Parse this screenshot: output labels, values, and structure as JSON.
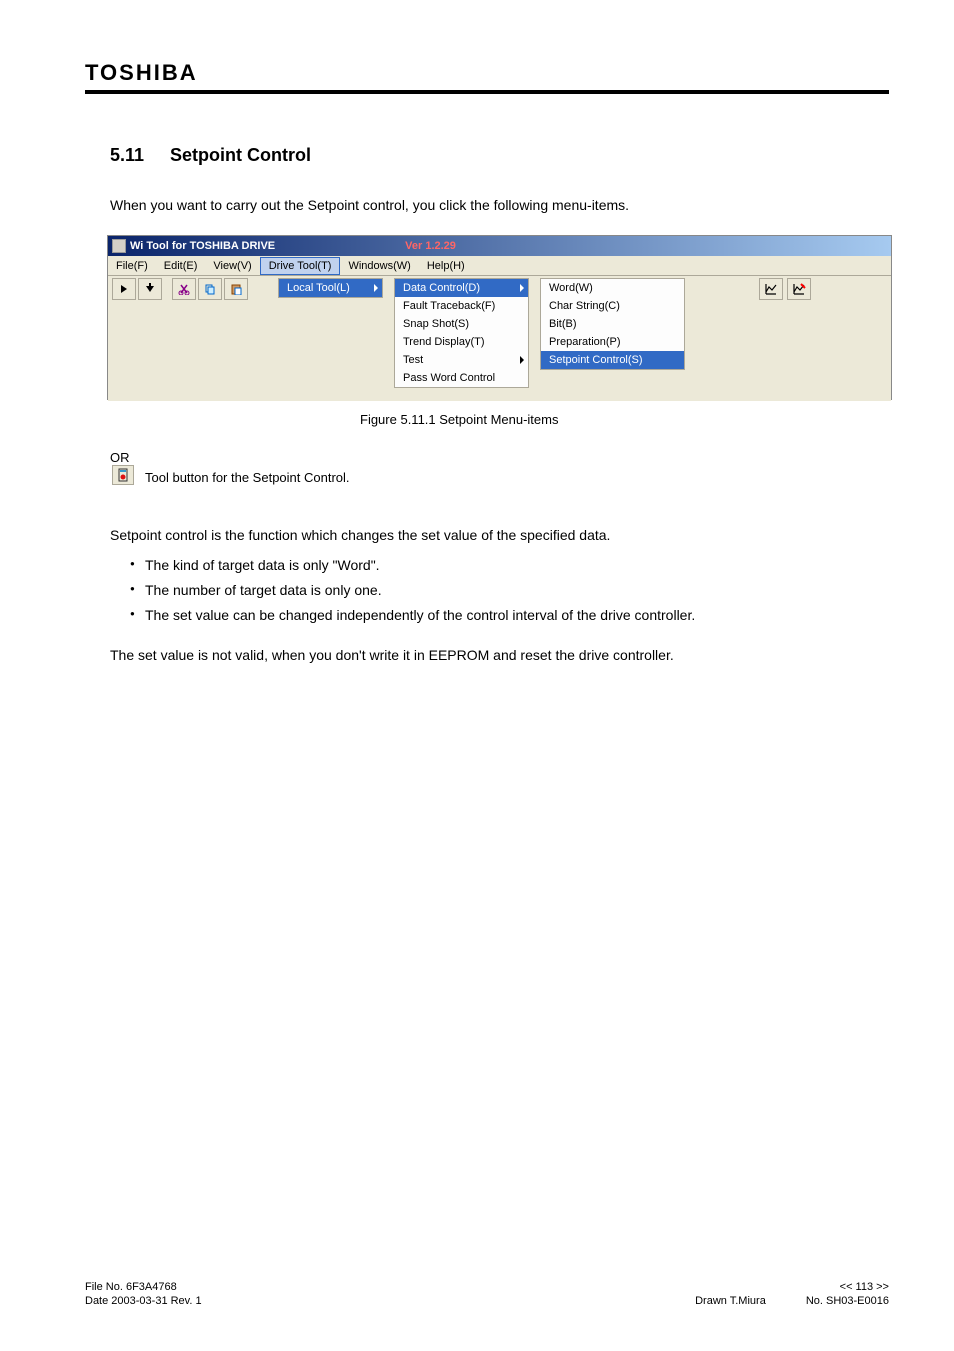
{
  "brand": "TOSHIBA",
  "section": {
    "number": "5.11",
    "title": "Setpoint Control"
  },
  "intro": "When you want to carry out the Setpoint control, you click the following menu-items.",
  "window": {
    "title": "Wi Tool for TOSHIBA DRIVE",
    "version": "Ver 1.2.29",
    "menubar": [
      {
        "label": "File(F)"
      },
      {
        "label": "Edit(E)"
      },
      {
        "label": "View(V)"
      },
      {
        "label": "Drive Tool(T)"
      },
      {
        "label": "Windows(W)"
      },
      {
        "label": "Help(H)"
      }
    ],
    "submenu1": [
      {
        "label": "Local Tool(L)",
        "hasArrow": true,
        "highlighted": true
      }
    ],
    "submenu2": [
      {
        "label": "Data Control(D)",
        "hasArrow": true,
        "highlighted": true
      },
      {
        "label": "Fault Traceback(F)"
      },
      {
        "label": "Snap Shot(S)"
      },
      {
        "label": "Trend Display(T)"
      },
      {
        "label": "Test",
        "hasArrow": true
      },
      {
        "label": "Pass Word Control"
      }
    ],
    "submenu3": [
      {
        "label": "Word(W)"
      },
      {
        "label": "Char String(C)"
      },
      {
        "label": "Bit(B)"
      },
      {
        "label": "Preparation(P)"
      },
      {
        "label": "Setpoint Control(S)",
        "highlighted": true
      }
    ]
  },
  "figure_caption": "Figure 5.11.1 Setpoint Menu-items",
  "or_text": "OR",
  "tool_button_text": "Tool button for the Setpoint Control.",
  "setpoint_desc": "Setpoint control is the function which changes the set value of the specified data.",
  "setpoint_notes": [
    "The kind of target data is only \"Word\".",
    "The number of target data is only one.",
    "The set value can be changed independently of the control interval of the drive controller."
  ],
  "note": "The set value is not valid, when you don't write it in EEPROM and reset the drive controller.",
  "footer": {
    "left_top": "File No. 6F3A4768",
    "left_bottom": "Date 2003-03-31 Rev. 1",
    "right_top": "<< 113 >>",
    "right_bottom_left": "Drawn T.Miura",
    "right_bottom_right": "No. SH03-E0016"
  }
}
